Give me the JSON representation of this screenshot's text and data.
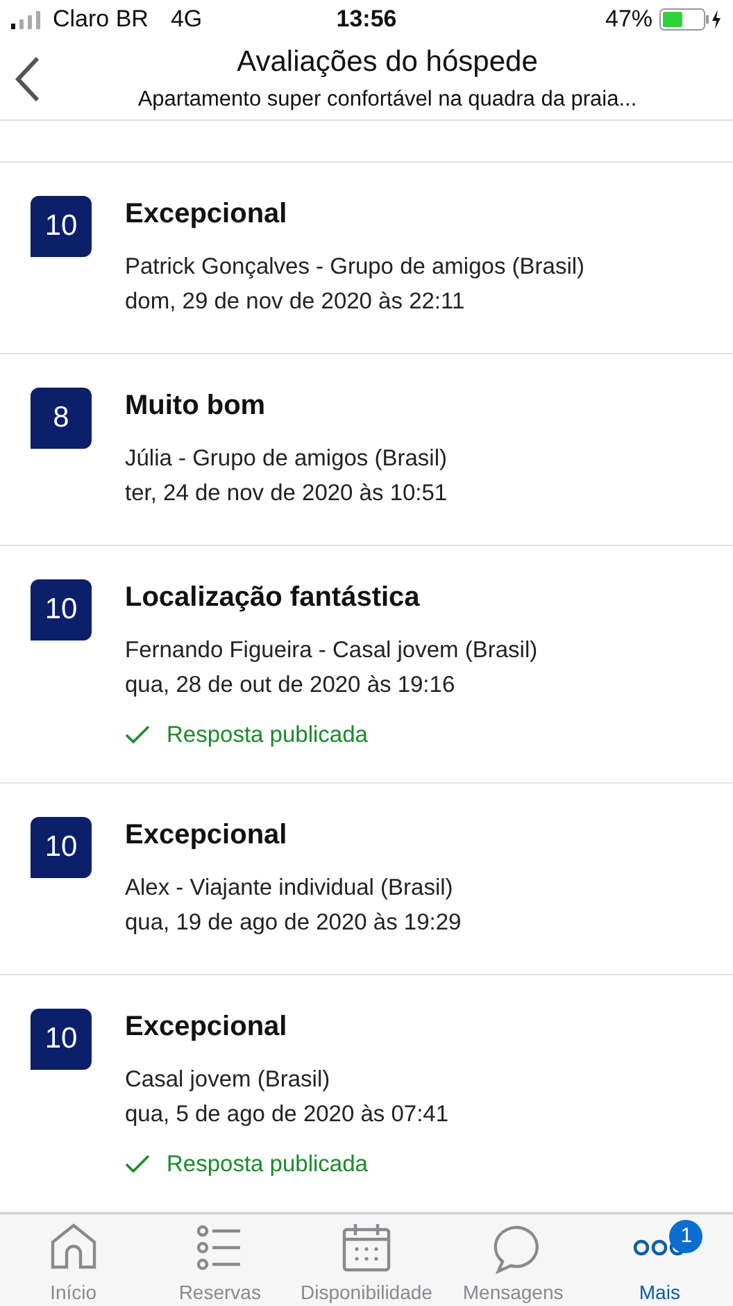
{
  "status_bar": {
    "carrier": "Claro BR",
    "network": "4G",
    "time": "13:56",
    "battery": "47%"
  },
  "header": {
    "title": "Avaliações do hóspede",
    "subtitle": "Apartamento super confortável na quadra da praia..."
  },
  "reviews": [
    {
      "score": "10",
      "title": "Excepcional",
      "guest": "Patrick Gonçalves - Grupo de amigos (Brasil)",
      "date": "dom, 29 de nov de 2020 às 22:11",
      "replied": false
    },
    {
      "score": "8",
      "title": "Muito bom",
      "guest": "Júlia - Grupo de amigos (Brasil)",
      "date": "ter, 24 de nov de 2020 às 10:51",
      "replied": false
    },
    {
      "score": "10",
      "title": "Localização fantástica",
      "guest": "Fernando Figueira - Casal jovem (Brasil)",
      "date": "qua, 28 de out de 2020 às 19:16",
      "replied": true,
      "reply_label": "Resposta publicada"
    },
    {
      "score": "10",
      "title": "Excepcional",
      "guest": "Alex - Viajante individual (Brasil)",
      "date": "qua, 19 de ago de 2020 às 19:29",
      "replied": false
    },
    {
      "score": "10",
      "title": "Excepcional",
      "guest": "Casal jovem (Brasil)",
      "date": "qua, 5 de ago de 2020 às 07:41",
      "replied": true,
      "reply_label": "Resposta publicada"
    }
  ],
  "tab_bar": [
    {
      "kind": "home",
      "label": "Início",
      "selected": false
    },
    {
      "kind": "list",
      "label": "Reservas",
      "selected": false
    },
    {
      "kind": "calendar",
      "label": "Disponibilidade",
      "selected": false
    },
    {
      "kind": "chat",
      "label": "Mensagens",
      "selected": false
    },
    {
      "kind": "more",
      "label": "Mais",
      "selected": true,
      "badge": "1"
    }
  ]
}
